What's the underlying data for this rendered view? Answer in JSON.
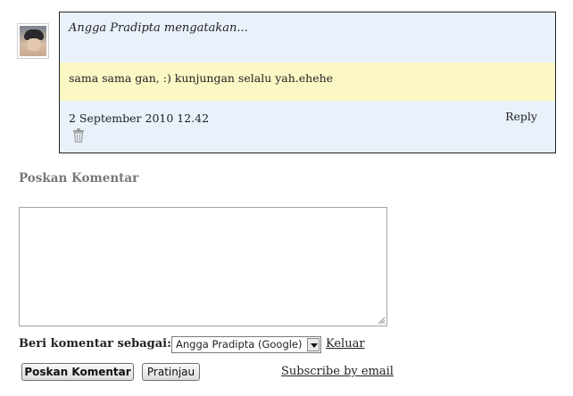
{
  "comment": {
    "author_line": "Angga Pradipta mengatakan...",
    "body": "sama sama gan, :) kunjungan selalu yah.ehehe",
    "timestamp": "2 September 2010 12.42",
    "reply_label": "Reply",
    "delete_icon": "trash-icon"
  },
  "form": {
    "section_title": "Poskan Komentar",
    "comment_value": "",
    "identity_label": "Beri komentar sebagai:",
    "identity_selected": "Angga Pradipta (Google)",
    "logout_label": "Keluar",
    "post_button": "Poskan Komentar",
    "preview_button": "Pratinjau",
    "subscribe_label": "Subscribe by email"
  },
  "colors": {
    "comment_background": "#e9f1fb",
    "body_highlight": "#fbf8c5",
    "section_title": "#777777"
  }
}
